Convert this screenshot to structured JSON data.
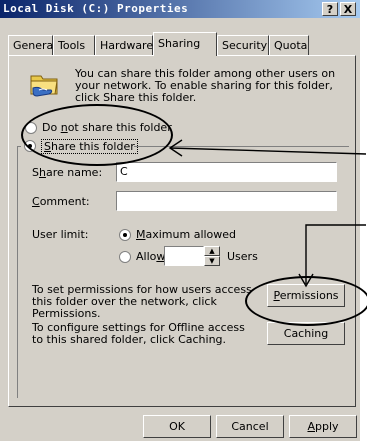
{
  "window": {
    "title": "Local Disk (C:) Properties",
    "help_button": "?",
    "close_button": "X"
  },
  "tabs": [
    {
      "label": "General",
      "active": false
    },
    {
      "label": "Tools",
      "active": false
    },
    {
      "label": "Hardware",
      "active": false
    },
    {
      "label": "Sharing",
      "active": true
    },
    {
      "label": "Security",
      "active": false
    },
    {
      "label": "Quota",
      "active": false
    }
  ],
  "sharing": {
    "intro_text": "You can share this folder among other users on your network. To enable sharing for this folder, click Share this folder.",
    "folder_icon": "shared-folder-icon",
    "do_not_share": {
      "pre": "Do ",
      "accel": "n",
      "post": "ot share this folder",
      "selected": false
    },
    "share_this": {
      "pre": "",
      "accel": "S",
      "post": "hare this folder",
      "selected": true
    },
    "share_name": {
      "pre": "S",
      "accel": "h",
      "post": "are name:",
      "value": "C"
    },
    "comment": {
      "pre": "",
      "accel": "C",
      "post": "omment:",
      "value": ""
    },
    "user_limit_label": "User limit:",
    "max_allowed": {
      "pre": "",
      "accel": "M",
      "post": "aximum allowed",
      "selected": true
    },
    "allow": {
      "pre": "Allo",
      "accel": "w",
      "post": "",
      "selected": false,
      "value": ""
    },
    "users_label": "Users",
    "permissions_text": "To set permissions for how users access this folder over the network, click Permissions.",
    "permissions_button": {
      "pre": "",
      "accel": "P",
      "post": "ermissions"
    },
    "caching_text": "To configure settings for Offline access to this shared folder, click Caching.",
    "caching_button": "Caching"
  },
  "footer": {
    "ok": "OK",
    "cancel": "Cancel",
    "apply": {
      "pre": "",
      "accel": "A",
      "post": "pply"
    }
  },
  "annotations": {
    "color": "#000000"
  }
}
